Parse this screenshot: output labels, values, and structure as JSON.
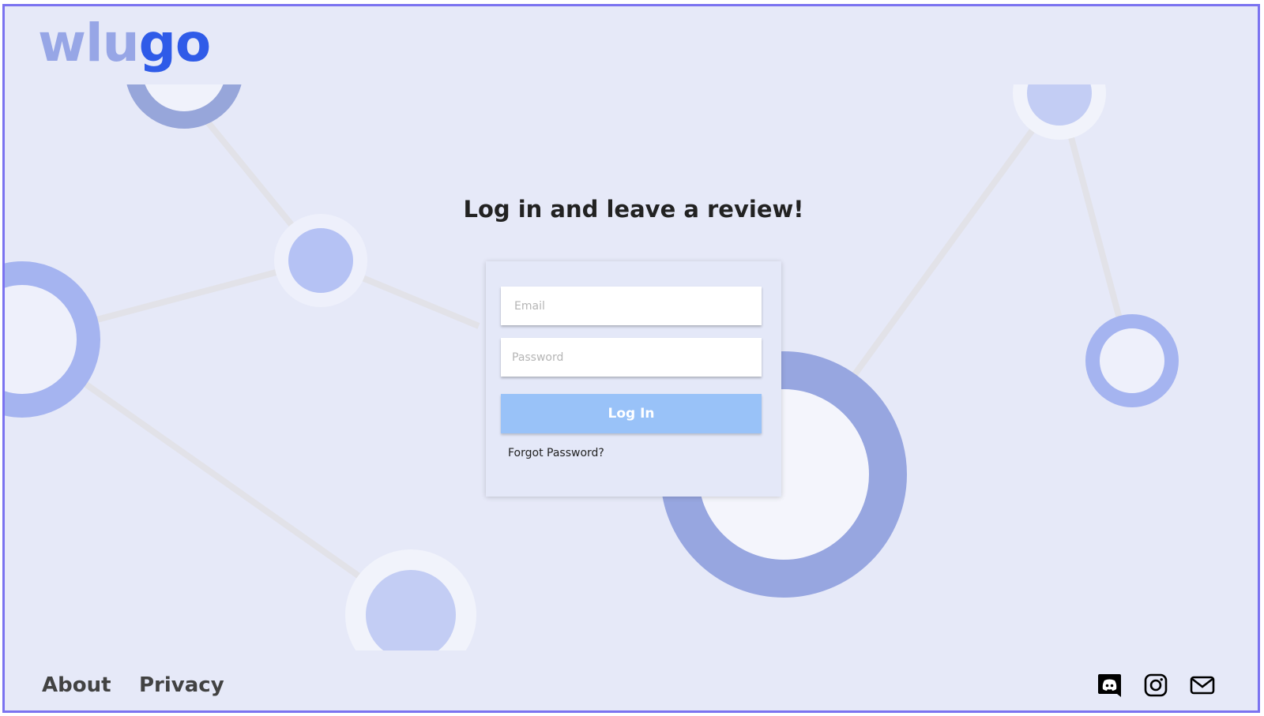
{
  "brand": {
    "logo_part1": "wlu",
    "logo_part2": "go",
    "color_light": "#97a6e6",
    "color_dark": "#2f5be8"
  },
  "main": {
    "headline": "Log in and leave a review!"
  },
  "login_form": {
    "email_placeholder": "Email",
    "password_placeholder": "Password",
    "submit_label": "Log In",
    "forgot_label": "Forgot Password?",
    "button_color": "#99c2f8"
  },
  "footer": {
    "about_label": "About",
    "privacy_label": "Privacy",
    "social_icons": [
      "discord-icon",
      "instagram-icon",
      "mail-icon"
    ]
  },
  "colors": {
    "frame_border": "#7b73f0",
    "background": "#e6e9f8"
  }
}
